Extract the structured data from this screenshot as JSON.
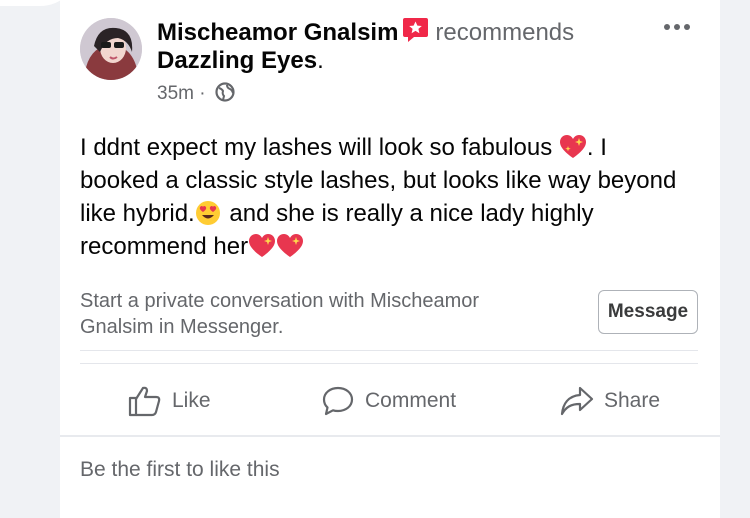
{
  "post": {
    "author": "Mischeamor Gnalsim",
    "recommends": "recommends",
    "business": "Dazzling Eyes",
    "business_suffix": ".",
    "time": "35m",
    "separator": "·",
    "text_part1": "I ddnt expect my lashes will look so fabulous ",
    "text_part2": ". I booked a classic style lashes, but looks like way beyond like hybrid.",
    "text_part3": "  and she is really a nice lady highly recommend her",
    "icons": [
      "star-badge-icon",
      "globe-icon",
      "more-icon",
      "sparkling-heart-emoji",
      "heart-eyes-emoji"
    ]
  },
  "messenger": {
    "prompt": "Start a private conversation with Mischeamor Gnalsim in Messenger.",
    "button_label": "Message"
  },
  "actions": {
    "like": "Like",
    "comment": "Comment",
    "share": "Share"
  },
  "reactions": {
    "summary": "Be the first to like this"
  },
  "colors": {
    "background": "#f0f2f5",
    "card": "#ffffff",
    "secondary_text": "#65676b",
    "badge_red": "#f02849"
  }
}
